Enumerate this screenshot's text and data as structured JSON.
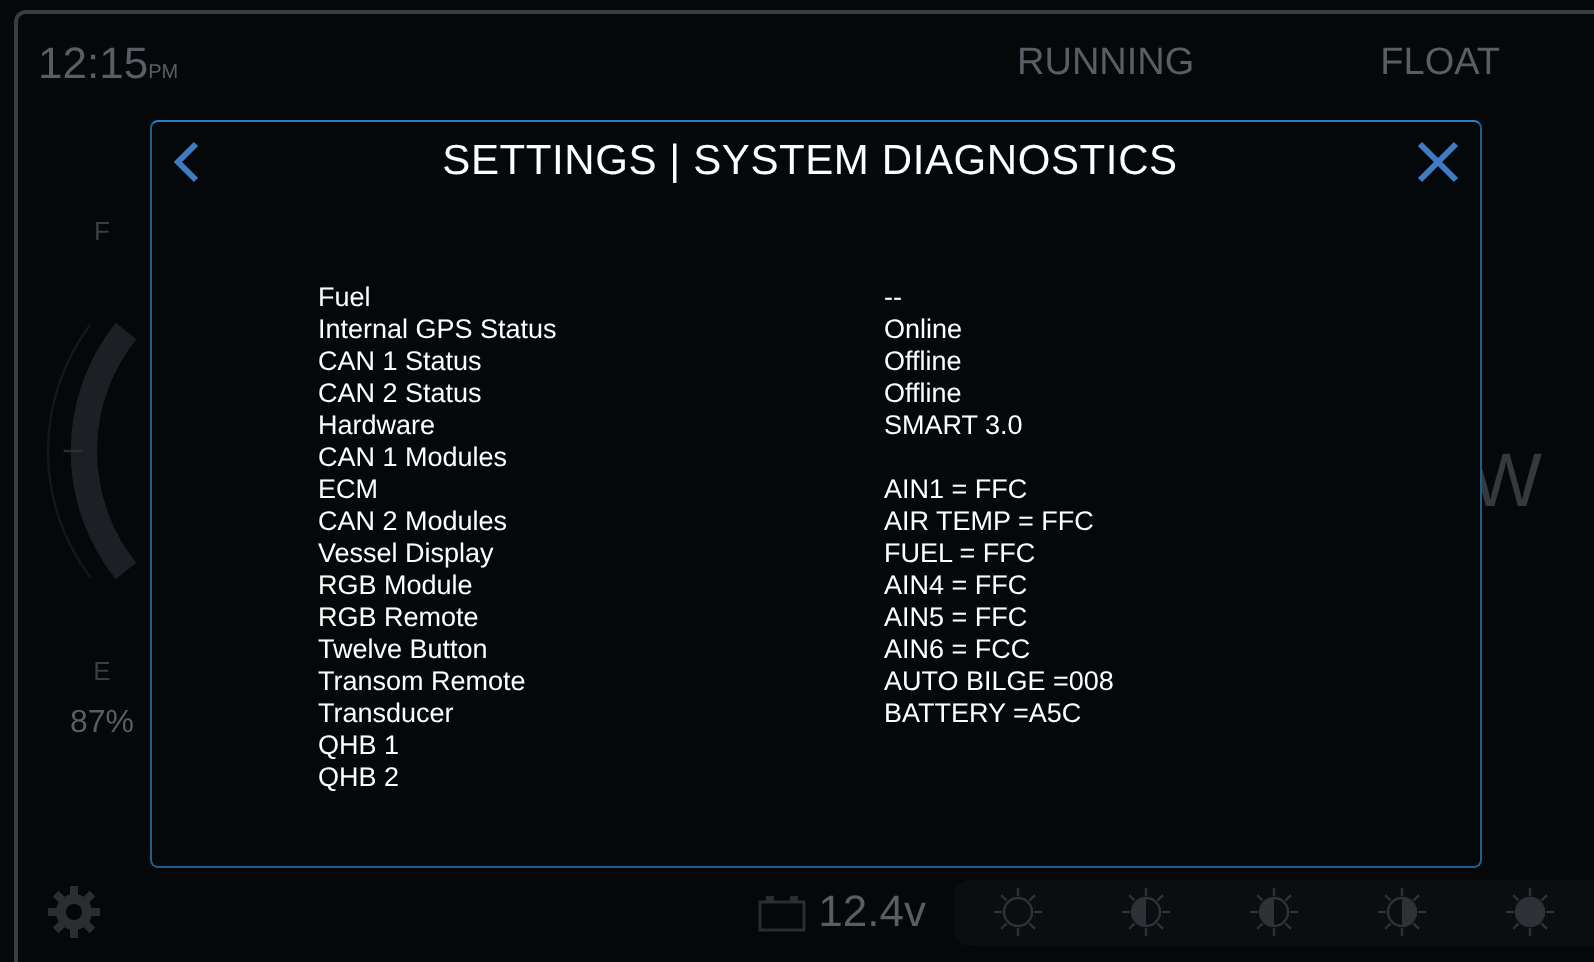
{
  "status_bar": {
    "time": "12:15",
    "meridiem": "PM",
    "engine_state": "RUNNING",
    "float_state": "FLOAT"
  },
  "gauge": {
    "full_label": "F",
    "empty_label": "E",
    "reading": "87%"
  },
  "right_gauge": {
    "partial_text": "W"
  },
  "bottom_bar": {
    "battery_voltage": "12.4v"
  },
  "dialog": {
    "title": "SETTINGS | SYSTEM DIAGNOSTICS",
    "rows": [
      {
        "label": "Fuel",
        "value": "--"
      },
      {
        "label": "Internal GPS Status",
        "value": "Online"
      },
      {
        "label": "CAN 1 Status",
        "value": "Offline"
      },
      {
        "label": "CAN 2 Status",
        "value": "Offline"
      },
      {
        "label": "Hardware",
        "value": "SMART 3.0"
      },
      {
        "label": "CAN 1 Modules"
      },
      {
        "label": "ECM",
        "value": "AIN1 = FFC"
      },
      {
        "label": "CAN 2 Modules",
        "value": "AIR TEMP = FFC"
      },
      {
        "label": "Vessel Display",
        "value": "FUEL = FFC"
      },
      {
        "label": "RGB Module",
        "value": "AIN4 = FFC"
      },
      {
        "label": "RGB Remote",
        "value": "AIN5 = FFC"
      },
      {
        "label": "Twelve Button",
        "value": "AIN6 = FCC"
      },
      {
        "label": "Transom Remote",
        "value": "AUTO BILGE =008"
      },
      {
        "label": "Transducer",
        "value": "BATTERY =A5C"
      },
      {
        "label": "QHB 1"
      },
      {
        "label": "QHB 2"
      }
    ]
  }
}
